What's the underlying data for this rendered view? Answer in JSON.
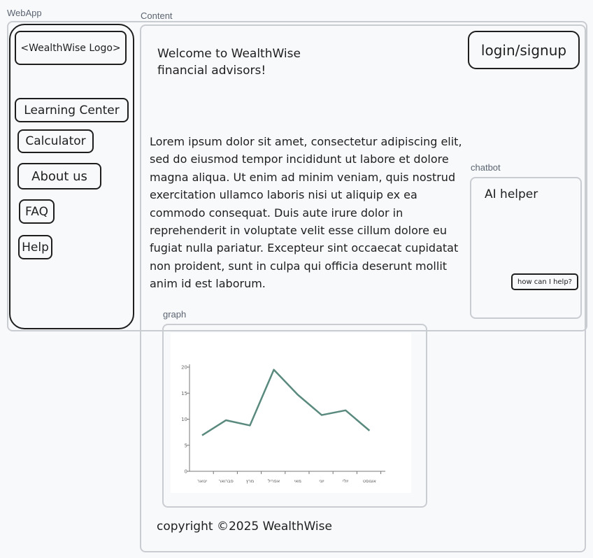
{
  "frames": {
    "webapp": "WebApp",
    "content": "Content",
    "chatbot": "chatbot",
    "graph": "graph"
  },
  "sidebar": {
    "logo": "<WealthWise Logo>",
    "items": [
      {
        "label": "Learning Center"
      },
      {
        "label": "Calculator"
      },
      {
        "label": "About us"
      },
      {
        "label": "FAQ"
      },
      {
        "label": "Help"
      }
    ]
  },
  "header": {
    "welcome_line1": "Welcome to WealthWise",
    "welcome_line2": "financial advisors!",
    "login": "login/signup"
  },
  "main": {
    "body": "Lorem ipsum dolor sit amet, consectetur adipiscing elit, sed do eiusmod tempor incididunt ut labore et dolore magna aliqua. Ut enim ad minim veniam, quis nostrud exercitation ullamco laboris nisi ut aliquip ex ea commodo consequat. Duis aute irure dolor in reprehenderit in voluptate velit esse cillum dolore eu fugiat nulla pariatur. Excepteur sint occaecat cupidatat non proident, sunt in culpa qui officia deserunt mollit anim id est laborum."
  },
  "chatbot": {
    "title": "AI helper",
    "button": "how can I help?"
  },
  "footer": {
    "copyright": "copyright ©2025 WealthWise"
  },
  "chart_data": {
    "type": "line",
    "categories": [
      "ינואר",
      "פברואר",
      "מרץ",
      "אפריל",
      "מאי",
      "יוני",
      "יולי",
      "אוגוסט"
    ],
    "values": [
      6.9,
      9.8,
      8.8,
      19.5,
      14.7,
      10.8,
      11.7,
      7.8
    ],
    "yticks": [
      0,
      5,
      10,
      15,
      20
    ],
    "ylim": [
      0,
      20
    ],
    "color": "#5a8a7e",
    "title": "",
    "xlabel": "",
    "ylabel": ""
  }
}
